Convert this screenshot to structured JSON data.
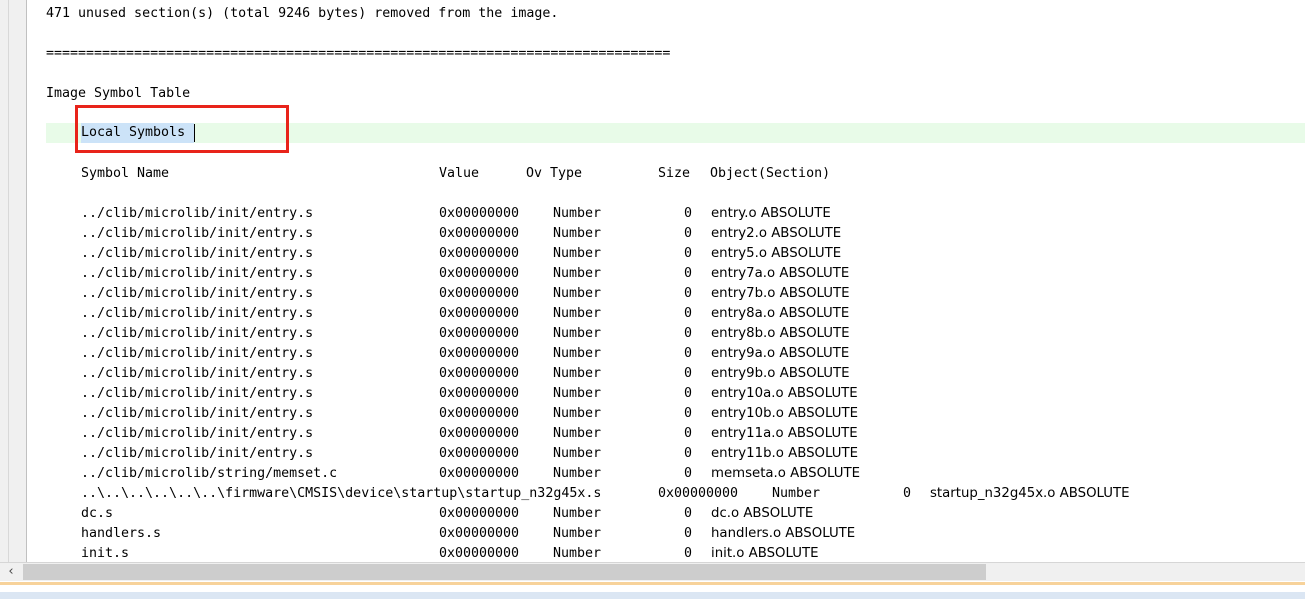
{
  "header_text": "471 unused section(s) (total 9246 bytes) removed from the image.",
  "separator": "==============================================================================",
  "table_title": "Image Symbol Table",
  "section_title": "Local Symbols",
  "columns": {
    "symbol_name": "Symbol Name",
    "value": "Value",
    "ov_type": "Ov Type",
    "size": "Size",
    "object_section": "Object(Section)"
  },
  "rows": [
    {
      "name": "../clib/microlib/init/entry.s",
      "value": "0x00000000",
      "type": "Number",
      "size": "0",
      "object": "entry.o ABSOLUTE"
    },
    {
      "name": "../clib/microlib/init/entry.s",
      "value": "0x00000000",
      "type": "Number",
      "size": "0",
      "object": "entry2.o ABSOLUTE"
    },
    {
      "name": "../clib/microlib/init/entry.s",
      "value": "0x00000000",
      "type": "Number",
      "size": "0",
      "object": "entry5.o ABSOLUTE"
    },
    {
      "name": "../clib/microlib/init/entry.s",
      "value": "0x00000000",
      "type": "Number",
      "size": "0",
      "object": "entry7a.o ABSOLUTE"
    },
    {
      "name": "../clib/microlib/init/entry.s",
      "value": "0x00000000",
      "type": "Number",
      "size": "0",
      "object": "entry7b.o ABSOLUTE"
    },
    {
      "name": "../clib/microlib/init/entry.s",
      "value": "0x00000000",
      "type": "Number",
      "size": "0",
      "object": "entry8a.o ABSOLUTE"
    },
    {
      "name": "../clib/microlib/init/entry.s",
      "value": "0x00000000",
      "type": "Number",
      "size": "0",
      "object": "entry8b.o ABSOLUTE"
    },
    {
      "name": "../clib/microlib/init/entry.s",
      "value": "0x00000000",
      "type": "Number",
      "size": "0",
      "object": "entry9a.o ABSOLUTE"
    },
    {
      "name": "../clib/microlib/init/entry.s",
      "value": "0x00000000",
      "type": "Number",
      "size": "0",
      "object": "entry9b.o ABSOLUTE"
    },
    {
      "name": "../clib/microlib/init/entry.s",
      "value": "0x00000000",
      "type": "Number",
      "size": "0",
      "object": "entry10a.o ABSOLUTE"
    },
    {
      "name": "../clib/microlib/init/entry.s",
      "value": "0x00000000",
      "type": "Number",
      "size": "0",
      "object": "entry10b.o ABSOLUTE"
    },
    {
      "name": "../clib/microlib/init/entry.s",
      "value": "0x00000000",
      "type": "Number",
      "size": "0",
      "object": "entry11a.o ABSOLUTE"
    },
    {
      "name": "../clib/microlib/init/entry.s",
      "value": "0x00000000",
      "type": "Number",
      "size": "0",
      "object": "entry11b.o ABSOLUTE"
    },
    {
      "name": "../clib/microlib/string/memset.c",
      "value": "0x00000000",
      "type": "Number",
      "size": "0",
      "object": "memseta.o ABSOLUTE"
    },
    {
      "name": "..\\..\\..\\..\\..\\..\\firmware\\CMSIS\\device\\startup\\startup_n32g45x.s",
      "value": "0x00000000",
      "type": "Number",
      "size": "0",
      "object": "startup_n32g45x.o ABSOLUTE",
      "overflow": true
    },
    {
      "name": "dc.s",
      "value": "0x00000000",
      "type": "Number",
      "size": "0",
      "object": "dc.o ABSOLUTE"
    },
    {
      "name": "handlers.s",
      "value": "0x00000000",
      "type": "Number",
      "size": "0",
      "object": "handlers.o ABSOLUTE"
    },
    {
      "name": "init.s",
      "value": "0x00000000",
      "type": "Number",
      "size": "0",
      "object": "init.o ABSOLUTE"
    }
  ],
  "scrollbar": {
    "left_arrow": "‹"
  },
  "colors": {
    "highlight_line": "#e8fbe8",
    "selection": "#cce3f8",
    "annotation_box": "#e8231a"
  }
}
